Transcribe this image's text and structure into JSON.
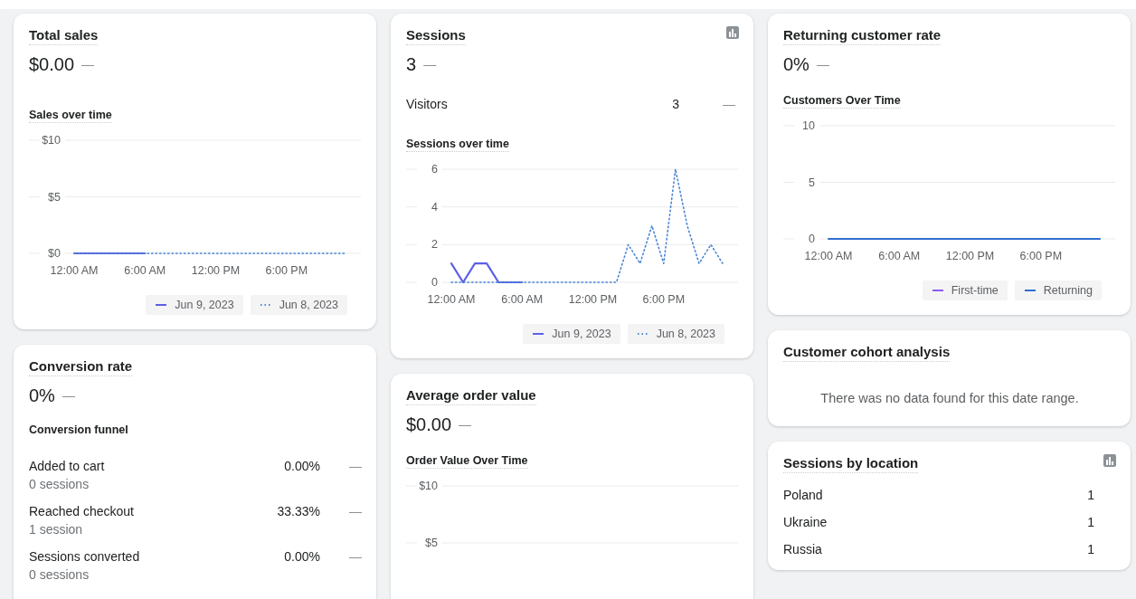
{
  "columns": [
    {
      "cards": [
        {
          "kind": "metric_chart",
          "title": "Total sales",
          "value": "$0.00",
          "change": "—",
          "subtitle": "Sales over time",
          "chart_data": {
            "type": "line",
            "legend": "bottom",
            "ylim": [
              0,
              10
            ],
            "yticks": [
              {
                "value": 0,
                "label": "$0"
              },
              {
                "value": 5,
                "label": "$5"
              },
              {
                "value": 10,
                "label": "$10"
              }
            ],
            "categories": [
              "12:00 AM",
              null,
              null,
              null,
              null,
              null,
              "6:00 AM",
              null,
              null,
              null,
              null,
              null,
              "12:00 PM",
              null,
              null,
              null,
              null,
              null,
              "6:00 PM",
              null,
              null,
              null,
              null,
              null
            ],
            "series": [
              {
                "name": "Jun 9, 2023",
                "color": "#5c5fe6",
                "line_style": "solid",
                "values": [
                  0,
                  0,
                  0,
                  0,
                  0,
                  0,
                  0,
                  null,
                  null,
                  null,
                  null,
                  null,
                  null,
                  null,
                  null,
                  null,
                  null,
                  null,
                  null,
                  null,
                  null,
                  null,
                  null,
                  null
                ]
              },
              {
                "name": "Jun 8, 2023",
                "color": "#4a86d4",
                "line_style": "dotted",
                "values": [
                  0,
                  0,
                  0,
                  0,
                  0,
                  0,
                  0,
                  0,
                  0,
                  0,
                  0,
                  0,
                  0,
                  0,
                  0,
                  0,
                  0,
                  0,
                  0,
                  0,
                  0,
                  0,
                  0,
                  0
                ]
              }
            ]
          }
        },
        {
          "kind": "funnel",
          "title": "Conversion rate",
          "value": "0%",
          "change": "—",
          "subtitle": "Conversion funnel",
          "steps": [
            {
              "label": "Added to cart",
              "sessions": "0 sessions",
              "rate": "0.00%",
              "change": "—"
            },
            {
              "label": "Reached checkout",
              "sessions": "1 session",
              "rate": "33.33%",
              "change": "—"
            },
            {
              "label": "Sessions converted",
              "sessions": "0 sessions",
              "rate": "0.00%",
              "change": "—"
            }
          ]
        }
      ]
    },
    {
      "cards": [
        {
          "kind": "metric_chart",
          "title": "Sessions",
          "value": "3",
          "change": "—",
          "chart_toggle": true,
          "breakdown": [
            {
              "label": "Visitors",
              "value": "3",
              "change": "—"
            }
          ],
          "subtitle": "Sessions over time",
          "chart_data": {
            "type": "line",
            "legend": "bottom",
            "ylim": [
              0,
              6
            ],
            "yticks": [
              0,
              2,
              4,
              6
            ],
            "categories": [
              "12:00 AM",
              null,
              null,
              null,
              null,
              null,
              "6:00 AM",
              null,
              null,
              null,
              null,
              null,
              "12:00 PM",
              null,
              null,
              null,
              null,
              null,
              "6:00 PM",
              null,
              null,
              null,
              null,
              null
            ],
            "series": [
              {
                "name": "Jun 9, 2023",
                "color": "#5c5fe6",
                "line_style": "solid",
                "values": [
                  1,
                  0,
                  1,
                  1,
                  0,
                  0,
                  0,
                  null,
                  null,
                  null,
                  null,
                  null,
                  null,
                  null,
                  null,
                  null,
                  null,
                  null,
                  null,
                  null,
                  null,
                  null,
                  null,
                  null
                ]
              },
              {
                "name": "Jun 8, 2023",
                "color": "#4a86d4",
                "line_style": "dotted",
                "values": [
                  0,
                  0,
                  0,
                  0,
                  0,
                  0,
                  0,
                  0,
                  0,
                  0,
                  0,
                  0,
                  0,
                  0,
                  0,
                  2,
                  1,
                  3,
                  1,
                  6,
                  3,
                  1,
                  2,
                  1
                ]
              }
            ]
          }
        },
        {
          "kind": "metric_grid",
          "title": "Average order value",
          "value": "$0.00",
          "change": "—",
          "subtitle": "Order Value Over Time",
          "grid_labels": [
            "$10",
            "$5"
          ]
        }
      ]
    },
    {
      "cards": [
        {
          "kind": "metric_chart",
          "title": "Returning customer rate",
          "value": "0%",
          "change": "—",
          "subtitle": "Customers Over Time",
          "chart_data": {
            "type": "line",
            "legend": "bottom",
            "ylim": [
              0,
              10
            ],
            "yticks": [
              0,
              5,
              10
            ],
            "categories": [
              "12:00 AM",
              null,
              null,
              null,
              null,
              null,
              "6:00 AM",
              null,
              null,
              null,
              null,
              null,
              "12:00 PM",
              null,
              null,
              null,
              null,
              null,
              "6:00 PM",
              null,
              null,
              null,
              null,
              null
            ],
            "series": [
              {
                "name": "First-time",
                "color": "#8c5cf0",
                "line_style": "solid",
                "values": [
                  null,
                  null,
                  null,
                  null,
                  null,
                  null,
                  null,
                  null,
                  null,
                  null,
                  null,
                  null,
                  null,
                  null,
                  null,
                  null,
                  null,
                  null,
                  null,
                  null,
                  null,
                  null,
                  null,
                  null
                ]
              },
              {
                "name": "Returning",
                "color": "#2f6fd0",
                "line_style": "solid",
                "values": [
                  0,
                  0,
                  0,
                  0,
                  0,
                  0,
                  0,
                  0,
                  0,
                  0,
                  0,
                  0,
                  0,
                  0,
                  0,
                  0,
                  0,
                  0,
                  0,
                  0,
                  0,
                  0,
                  0,
                  0
                ]
              }
            ]
          }
        },
        {
          "kind": "empty",
          "title": "Customer cohort analysis",
          "message": "There was no data found for this date range."
        },
        {
          "kind": "list",
          "title": "Sessions by location",
          "chart_toggle": true,
          "rows": [
            {
              "label": "Poland",
              "value": "1"
            },
            {
              "label": "Ukraine",
              "value": "1"
            },
            {
              "label": "Russia",
              "value": "1"
            }
          ]
        }
      ]
    }
  ]
}
